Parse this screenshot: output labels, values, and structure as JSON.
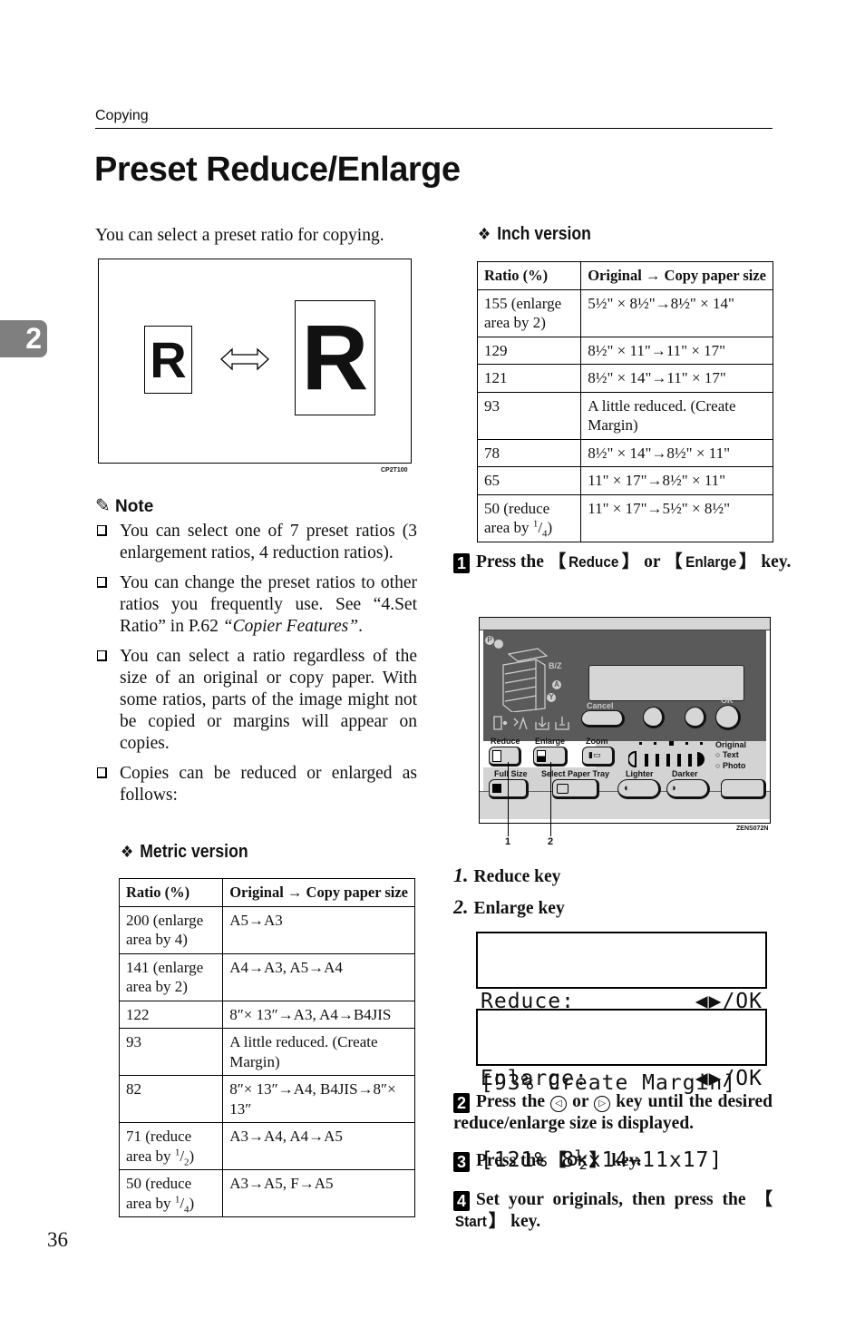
{
  "header": {
    "running_head": "Copying",
    "chapter_tab": "2",
    "page_title": "Preset Reduce/Enlarge"
  },
  "intro": "You can select a preset ratio for copying.",
  "figure": {
    "small_letter": "R",
    "large_letter": "R",
    "code": "CP2T100"
  },
  "note": {
    "heading": "Note",
    "items": [
      "You can select one of 7 preset ratios (3 enlargement ratios, 4 reduction ratios).",
      "You can change the preset ratios to other ratios you frequently use. See “4.Set Ratio” in P.62 ",
      "You can select a ratio regardless of the size of an original or copy paper. With some ratios, parts of the image might not be copied or margins will appear on copies.",
      "Copies can be reduced or enlarged as follows:"
    ],
    "item2_ref": "“Copier Features”",
    "item2_end": "."
  },
  "metric": {
    "heading": "Metric version",
    "col1": "Ratio (%)",
    "col2_a": "Original",
    "col2_arrow": "→",
    "col2_b": "Copy paper size",
    "rows": [
      {
        "ratio": "200 (enlarge area by 4)",
        "size": "A5→A3"
      },
      {
        "ratio": "141 (enlarge area by 2)",
        "size": "A4→A3, A5→A4"
      },
      {
        "ratio": "122",
        "size": "8″× 13″→A3, A4→B4JIS"
      },
      {
        "ratio": "93",
        "size": "A little reduced. (Create Margin)"
      },
      {
        "ratio": "82",
        "size": "8″× 13″→A4, B4JIS→8″× 13″"
      },
      {
        "ratio_a": "71 (reduce area by ",
        "ratio_num": "1",
        "ratio_den": "2",
        "size": "A3→A4, A4→A5"
      },
      {
        "ratio_a": "50 (reduce area by ",
        "ratio_num": "1",
        "ratio_den": "4",
        "size": "A3→A5, F→A5"
      }
    ]
  },
  "inch": {
    "heading": "Inch version",
    "col1": "Ratio (%)",
    "col2_a": "Original",
    "col2_arrow": "→",
    "col2_b": "Copy paper size",
    "rows": [
      {
        "ratio": "155 (enlarge area by 2)",
        "size": "5½\" × 8½\"→8½\" × 14\""
      },
      {
        "ratio": "129",
        "size": "8½\" × 11\"→11\" × 17\""
      },
      {
        "ratio": "121",
        "size": "8½\" × 14\"→11\" × 17\""
      },
      {
        "ratio": "93",
        "size": "A little reduced. (Create Margin)"
      },
      {
        "ratio": "78",
        "size": "8½\" × 14\"→8½\" × 11\""
      },
      {
        "ratio": "65",
        "size": "11\" × 17\"→8½\" × 11\""
      },
      {
        "ratio_a": "50 (reduce area by ",
        "ratio_num": "1",
        "ratio_den": "4",
        "size": "11\" × 17\"→5½\" × 8½\""
      }
    ]
  },
  "steps": {
    "s1": {
      "num": "1",
      "pre": "Press the ",
      "key1": "Reduce",
      "mid": " or ",
      "key2": "Enlarge",
      "post": " key."
    },
    "s2": {
      "num": "2",
      "pre": "Press the ",
      "left_key": "◁",
      "mid": " or ",
      "right_key": "▷",
      "post": " key until the desired reduce/enlarge size is displayed."
    },
    "s3": {
      "num": "3",
      "pre": "Press the ",
      "key": "OK",
      "post": " key."
    },
    "s4": {
      "num": "4",
      "pre": "Set your originals, then press the ",
      "key": "Start",
      "post": " key."
    }
  },
  "panel": {
    "cancel": "Cancel",
    "ok": "OK",
    "reduce": "Reduce",
    "enlarge": "Enlarge",
    "zoom": "Zoom",
    "full_size": "Full Size",
    "select_tray": "Select Paper Tray",
    "lighter": "Lighter",
    "darker": "Darker",
    "original": "Original",
    "text": "Text",
    "photo": "Photo",
    "tray_labels": [
      "P",
      "B/Z",
      "A",
      "Y"
    ],
    "callout1": "1",
    "callout2": "2",
    "code": "ZENS072N",
    "density_level": 3,
    "density_steps": 5
  },
  "legend": [
    {
      "num": "1.",
      "label": "Reduce key"
    },
    {
      "num": "2.",
      "label": "Enlarge key"
    }
  ],
  "displays": {
    "reduce": {
      "line1_left": "Reduce:",
      "line1_right": "◀▶/OK",
      "line2": "[93% Create Margin]"
    },
    "enlarge": {
      "line1_left": "Enlarge:",
      "line1_right": "◀▶/OK",
      "line2": "[121% 8½x14→11x17]"
    }
  },
  "page_number": "36"
}
